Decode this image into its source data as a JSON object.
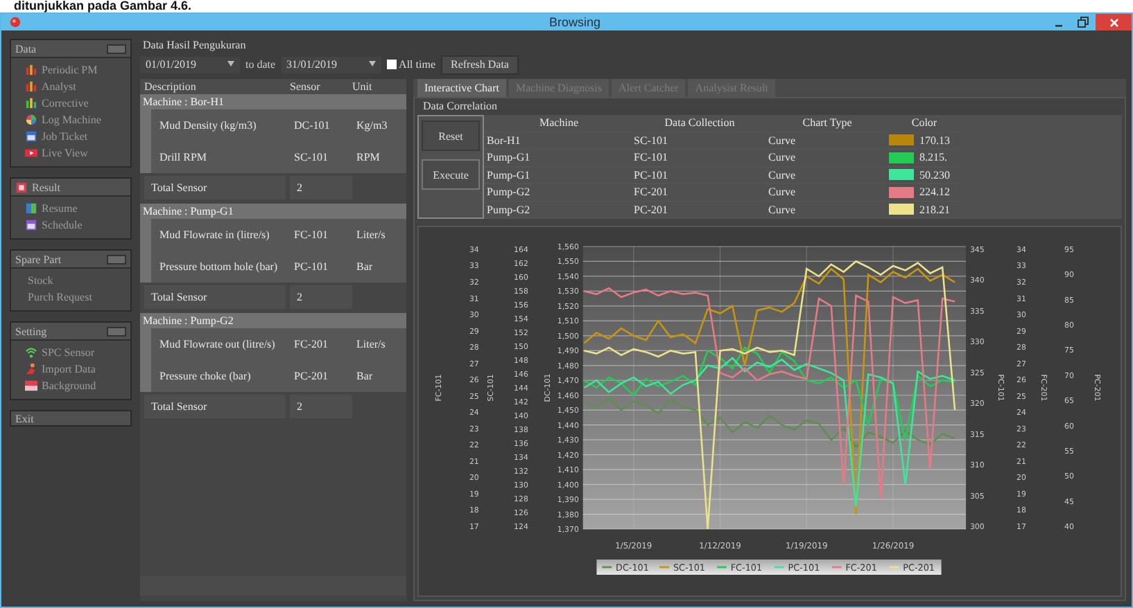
{
  "document_caption": "ditunjukkan pada Gambar 4.6.",
  "window": {
    "title": "Browsing"
  },
  "sidebar": {
    "groups": [
      {
        "title": "Data",
        "kind": "panel",
        "items": [
          "Periodic PM",
          "Analyst",
          "Corrective",
          "Log Machine",
          "Job Ticket",
          "Live View"
        ]
      },
      {
        "title": "Result",
        "kind": "icon-panel",
        "items": [
          "Resume",
          "Schedule"
        ]
      },
      {
        "title": "Spare Part",
        "kind": "panel",
        "items": [
          "Stock",
          "Purch Request"
        ]
      },
      {
        "title": "Setting",
        "kind": "panel",
        "items": [
          "SPC Sensor",
          "Import Data",
          "Background"
        ]
      },
      {
        "title": "Exit",
        "kind": "button"
      }
    ]
  },
  "measurement": {
    "title": "Data Hasil Pengukuran",
    "from_date": "01/01/2019",
    "to_label": "to date",
    "to_date": "31/01/2019",
    "all_time": {
      "label": "All time",
      "checked": false
    },
    "refresh_button": "Refresh Data",
    "table": {
      "columns": [
        "Description",
        "Sensor",
        "Unit"
      ],
      "machines": [
        {
          "name": "Machine : Bor-H1",
          "sensors": [
            {
              "description": "Mud Density (kg/m3)",
              "sensor": "DC-101",
              "unit": "Kg/m3"
            },
            {
              "description": "Drill RPM",
              "sensor": "SC-101",
              "unit": "RPM"
            }
          ],
          "total_label": "Total Sensor",
          "total": "2"
        },
        {
          "name": "Machine : Pump-G1",
          "sensors": [
            {
              "description": "Mud Flowrate in (litre/s)",
              "sensor": "FC-101",
              "unit": "Liter/s"
            },
            {
              "description": "Pressure bottom hole (bar)",
              "sensor": "PC-101",
              "unit": "Bar"
            }
          ],
          "total_label": "Total Sensor",
          "total": "2"
        },
        {
          "name": "Machine : Pump-G2",
          "sensors": [
            {
              "description": "Mud Flowrate out (litre/s)",
              "sensor": "FC-201",
              "unit": "Liter/s"
            },
            {
              "description": "Pressure choke (bar)",
              "sensor": "PC-201",
              "unit": "Bar"
            }
          ],
          "total_label": "Total Sensor",
          "total": "2"
        }
      ]
    }
  },
  "tabs": [
    {
      "label": "Interactive Chart",
      "selected": true
    },
    {
      "label": "Machine Diagnosis",
      "selected": false
    },
    {
      "label": "Alert Catcher",
      "selected": false
    },
    {
      "label": "Analysist Result",
      "selected": false
    }
  ],
  "correlation": {
    "title": "Data Correlation",
    "buttons": [
      "Reset",
      "Execute"
    ],
    "columns": [
      "Machine",
      "Data Collection",
      "Chart Type",
      "Color"
    ],
    "rows": [
      {
        "machine": "Bor-H1",
        "collection": "SC-101",
        "chart_type": "Curve",
        "color": "#b8860b",
        "value": "170.13"
      },
      {
        "machine": "Pump-G1",
        "collection": "FC-101",
        "chart_type": "Curve",
        "color": "#22cc55",
        "value": "8.215."
      },
      {
        "machine": "Pump-G1",
        "collection": "PC-101",
        "chart_type": "Curve",
        "color": "#3ee69a",
        "value": "50.230"
      },
      {
        "machine": "Pump-G2",
        "collection": "FC-201",
        "chart_type": "Curve",
        "color": "#e67a85",
        "value": "224.12"
      },
      {
        "machine": "Pump-G2",
        "collection": "PC-201",
        "chart_type": "Curve",
        "color": "#ebe28a",
        "value": "218.21"
      }
    ]
  },
  "chart": {
    "chart_data": {
      "type": "line",
      "ylabel": "DC-101",
      "categories": [
        null,
        null,
        null,
        null,
        "1/5/2019",
        null,
        null,
        null,
        null,
        null,
        null,
        "1/12/2019",
        null,
        null,
        null,
        null,
        null,
        null,
        "1/19/2019",
        null,
        null,
        null,
        null,
        null,
        null,
        "1/26/2019",
        null,
        null,
        null,
        null,
        null
      ],
      "ylim": [
        1370,
        1560
      ],
      "grid": true,
      "legend": "bottom",
      "yticks": [
        {
          "value": 1560,
          "label": "1,560"
        },
        {
          "value": 1550,
          "label": "1,550"
        },
        {
          "value": 1540,
          "label": "1,540"
        },
        {
          "value": 1530,
          "label": "1,530"
        },
        {
          "value": 1520,
          "label": "1,520"
        },
        {
          "value": 1510,
          "label": "1,510"
        },
        {
          "value": 1500,
          "label": "1,500"
        },
        {
          "value": 1490,
          "label": "1,490"
        },
        {
          "value": 1480,
          "label": "1,480"
        },
        {
          "value": 1470,
          "label": "1,470"
        },
        {
          "value": 1460,
          "label": "1,460"
        },
        {
          "value": 1450,
          "label": "1,450"
        },
        {
          "value": 1440,
          "label": "1,440"
        },
        {
          "value": 1430,
          "label": "1,430"
        },
        {
          "value": 1420,
          "label": "1,420"
        },
        {
          "value": 1410,
          "label": "1,410"
        },
        {
          "value": 1400,
          "label": "1,400"
        },
        {
          "value": 1390,
          "label": "1,390"
        },
        {
          "value": 1380,
          "label": "1,380"
        },
        {
          "value": 1370,
          "label": "1,370"
        }
      ],
      "series": [
        {
          "name": "DC-101",
          "color": "#5f8f4f",
          "values": [
            1455,
            1452,
            1458,
            1450,
            1456,
            1453,
            1448,
            1457,
            1452,
            1450,
            1440,
            1445,
            1435,
            1442,
            1438,
            1446,
            1440,
            1437,
            1443,
            1441,
            1430,
            1438,
            1425,
            1435,
            1432,
            1428,
            1436,
            1430,
            1427,
            1434,
            1431
          ]
        },
        {
          "name": "SC-101",
          "color": "#c8960c",
          "values": [
            1495,
            1502,
            1498,
            1505,
            1500,
            1497,
            1510,
            1499,
            1501,
            1495,
            1518,
            1515,
            1520,
            1480,
            1517,
            1519,
            1516,
            1522,
            1540,
            1535,
            1545,
            1538,
            1380,
            1541,
            1536,
            1543,
            1539,
            1545,
            1537,
            1541,
            1536
          ]
        },
        {
          "name": "FC-101",
          "color": "#22cc55",
          "values": [
            1470,
            1465,
            1472,
            1468,
            1460,
            1471,
            1466,
            1469,
            1473,
            1467,
            1490,
            1485,
            1478,
            1492,
            1488,
            1475,
            1489,
            1483,
            1470,
            1468,
            1472,
            1465,
            1470,
            1440,
            1471,
            1468,
            1430,
            1473,
            1466,
            1470,
            1469
          ]
        },
        {
          "name": "PC-101",
          "color": "#3ee69a",
          "values": [
            1465,
            1470,
            1462,
            1468,
            1472,
            1466,
            1469,
            1461,
            1467,
            1470,
            1480,
            1478,
            1485,
            1476,
            1482,
            1479,
            1484,
            1477,
            1481,
            1478,
            1475,
            1470,
            1385,
            1474,
            1472,
            1468,
            1400,
            1476,
            1471,
            1473,
            1470
          ]
        },
        {
          "name": "FC-201",
          "color": "#e67a85",
          "values": [
            1530,
            1528,
            1532,
            1526,
            1529,
            1531,
            1527,
            1530,
            1528,
            1529,
            1527,
            1475,
            1472,
            1478,
            1470,
            1474,
            1476,
            1473,
            1471,
            1525,
            1520,
            1400,
            1527,
            1523,
            1390,
            1526,
            1522,
            1524,
            1410,
            1525,
            1523
          ]
        },
        {
          "name": "PC-201",
          "color": "#ebe28a",
          "values": [
            1490,
            1488,
            1492,
            1487,
            1491,
            1489,
            1486,
            1490,
            1488,
            1489,
            1370,
            1490,
            1491,
            1488,
            1492,
            1489,
            1490,
            1487,
            1545,
            1540,
            1548,
            1543,
            1550,
            1546,
            1541,
            1547,
            1544,
            1549,
            1542,
            1546,
            1450
          ]
        }
      ]
    },
    "left_axes": [
      {
        "label": "FC-101",
        "ticks": [
          "34",
          "33",
          "32",
          "31",
          "30",
          "29",
          "28",
          "27",
          "26",
          "25",
          "24",
          "23",
          "22",
          "21",
          "20",
          "19",
          "18",
          "17"
        ]
      },
      {
        "label": "SC-101",
        "ticks": [
          "164",
          "162",
          "160",
          "158",
          "156",
          "154",
          "152",
          "150",
          "148",
          "146",
          "144",
          "142",
          "140",
          "138",
          "136",
          "134",
          "132",
          "130",
          "128",
          "126",
          "124"
        ]
      }
    ],
    "right_axes": [
      {
        "label": "PC-101",
        "ticks": [
          "345",
          "340",
          "335",
          "330",
          "325",
          "320",
          "315",
          "310",
          "305",
          "300"
        ]
      },
      {
        "label": "FC-201",
        "ticks": [
          "34",
          "33",
          "32",
          "31",
          "30",
          "29",
          "28",
          "27",
          "26",
          "25",
          "24",
          "23",
          "22",
          "21",
          "20",
          "19",
          "18",
          "17"
        ]
      },
      {
        "label": "PC-201",
        "ticks": [
          "95",
          "90",
          "85",
          "80",
          "75",
          "70",
          "65",
          "60",
          "55",
          "50",
          "45",
          "40"
        ]
      }
    ]
  }
}
